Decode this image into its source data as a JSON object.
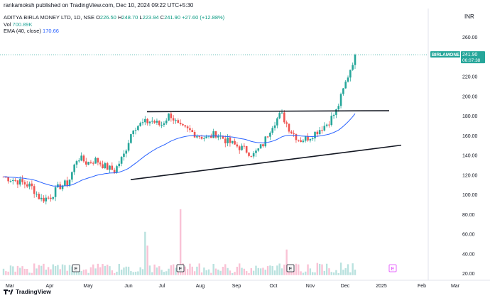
{
  "header": {
    "publisher": "rankamoksh published on TradingView.com, Dec 10, 2024 09:22 UTC+5:30",
    "currency": "INR"
  },
  "legend": {
    "symbol": "ADITYA BIRLA MONEY LTD, 1D, NSE",
    "o_label": "O",
    "o_value": "226.50",
    "h_label": "H",
    "h_value": "248.70",
    "l_label": "L",
    "l_value": "223.94",
    "c_label": "C",
    "c_value": "241.90",
    "change": "+27.60 (+12.88%)",
    "vol_label": "Vol",
    "vol_value": "700.89K",
    "ema_label": "EMA (40, close)",
    "ema_value": "170.66"
  },
  "price_tag": {
    "symbol": "BIRLAMONEY",
    "price": "241.90",
    "countdown": "06:07:38"
  },
  "footer": {
    "brand": "TradingView"
  },
  "colors": {
    "up": "#26a69a",
    "down": "#ef5350",
    "ema": "#2962ff",
    "event": "#e040fb"
  },
  "chart_data": {
    "type": "candlestick",
    "y_axis": {
      "range": [
        18,
        272
      ],
      "ticks": [
        20,
        40,
        60,
        80,
        100,
        120,
        140,
        160,
        180,
        200,
        220,
        240,
        260
      ]
    },
    "x_axis": {
      "labels": [
        "Mar",
        "Apr",
        "May",
        "Jun",
        "Jul",
        "Aug",
        "Sep",
        "Oct",
        "Nov",
        "Dec",
        "2025",
        "Feb",
        "Mar"
      ]
    },
    "price_series": [
      {
        "x": "Mar",
        "close": 118
      },
      {
        "x": "Mar",
        "close": 115
      },
      {
        "x": "Mar",
        "close": 112
      },
      {
        "x": "Mar",
        "close": 108
      },
      {
        "x": "Apr",
        "close": 95
      },
      {
        "x": "Apr",
        "close": 97
      },
      {
        "x": "Apr",
        "close": 108
      },
      {
        "x": "Apr",
        "close": 112
      },
      {
        "x": "May",
        "close": 138
      },
      {
        "x": "May",
        "close": 132
      },
      {
        "x": "May",
        "close": 135
      },
      {
        "x": "May",
        "close": 128
      },
      {
        "x": "Jun",
        "close": 124
      },
      {
        "x": "Jun",
        "close": 140
      },
      {
        "x": "Jun",
        "close": 168
      },
      {
        "x": "Jun",
        "close": 172
      },
      {
        "x": "Jul",
        "close": 175
      },
      {
        "x": "Jul",
        "close": 170
      },
      {
        "x": "Jul",
        "close": 182
      },
      {
        "x": "Jul",
        "close": 168
      },
      {
        "x": "Aug",
        "close": 165
      },
      {
        "x": "Aug",
        "close": 160
      },
      {
        "x": "Aug",
        "close": 157
      },
      {
        "x": "Aug",
        "close": 162
      },
      {
        "x": "Sep",
        "close": 155
      },
      {
        "x": "Sep",
        "close": 150
      },
      {
        "x": "Sep",
        "close": 146
      },
      {
        "x": "Sep",
        "close": 140
      },
      {
        "x": "Oct",
        "close": 150
      },
      {
        "x": "Oct",
        "close": 170
      },
      {
        "x": "Oct",
        "close": 182
      },
      {
        "x": "Oct",
        "close": 165
      },
      {
        "x": "Nov",
        "close": 155
      },
      {
        "x": "Nov",
        "close": 158
      },
      {
        "x": "Nov",
        "close": 165
      },
      {
        "x": "Nov",
        "close": 172
      },
      {
        "x": "Dec",
        "close": 185
      },
      {
        "x": "Dec",
        "close": 214
      },
      {
        "x": "Dec",
        "close": 241.9
      }
    ],
    "ema": {
      "name": "EMA (40, close)",
      "last": 170.66
    },
    "volume_labels": [
      "E",
      "E",
      "E",
      "E"
    ],
    "trendlines": [
      {
        "name": "resistance",
        "from": [
          "Jun",
          184
        ],
        "to": [
          "Dec",
          185
        ]
      },
      {
        "name": "support",
        "from": [
          "Jun",
          115
        ],
        "to": [
          "2025",
          150
        ]
      }
    ],
    "last_price": 241.9
  }
}
